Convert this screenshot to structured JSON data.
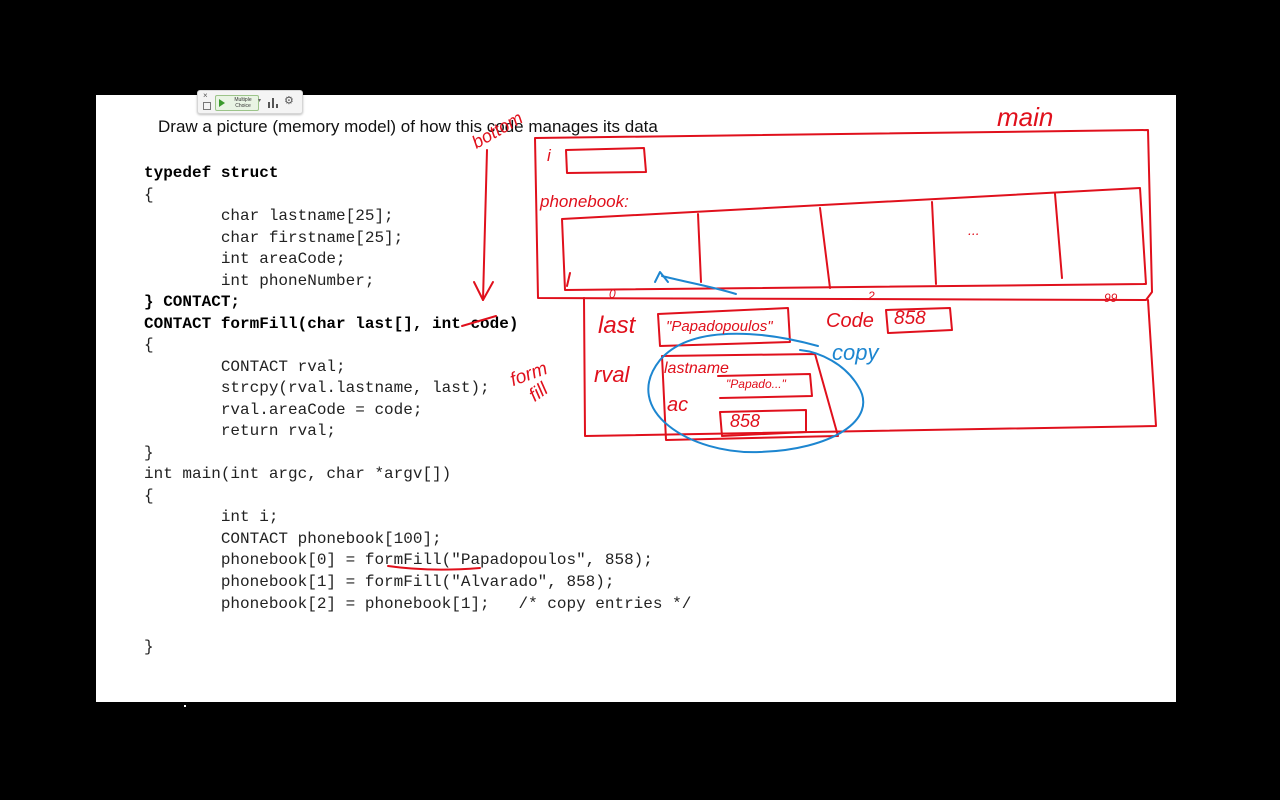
{
  "toolbar": {
    "close_icon": "×",
    "choice_label": "Multiple Choice",
    "chevron": "▾",
    "gear_icon": "⚙"
  },
  "slide": {
    "prompt": "Draw a picture (memory model) of how this code manages its data",
    "code_lines": [
      "typedef struct",
      "{",
      "        char lastname[25];",
      "        char firstname[25];",
      "        int areaCode;",
      "        int phoneNumber;",
      "} CONTACT;",
      "CONTACT formFill(char last[], int code)",
      "{",
      "        CONTACT rval;",
      "        strcpy(rval.lastname, last);",
      "        rval.areaCode = code;",
      "        return rval;",
      "}",
      "int main(int argc, char *argv[])",
      "{",
      "        int i;",
      "        CONTACT phonebook[100];",
      "        phonebook[0] = formFill(\"Papadopoulos\", 858);",
      "        phonebook[1] = formFill(\"Alvarado\", 858);",
      "        phonebook[2] = phonebook[1];   /* copy entries */",
      "",
      "}"
    ]
  },
  "annotations": {
    "main": "main",
    "bottom": "bottom",
    "i": "i",
    "phonebook": "phonebook:",
    "ellipsis": "...",
    "idx0": "0",
    "idx2": "2",
    "idx99": "99",
    "last": "last",
    "last_val": "\"Papadopoulos\"",
    "code": "Code",
    "code_val": "858",
    "copy": "copy",
    "rval": "rval",
    "form": "form",
    "fill": "fill",
    "lastname": "lastname",
    "lastname_val": "\"Papado...\"",
    "ac": "ac",
    "ac_val": "858"
  },
  "colors": {
    "ink_red": "#e0101c",
    "ink_blue": "#1d86d0",
    "background": "#000000",
    "slide": "#ffffff"
  }
}
